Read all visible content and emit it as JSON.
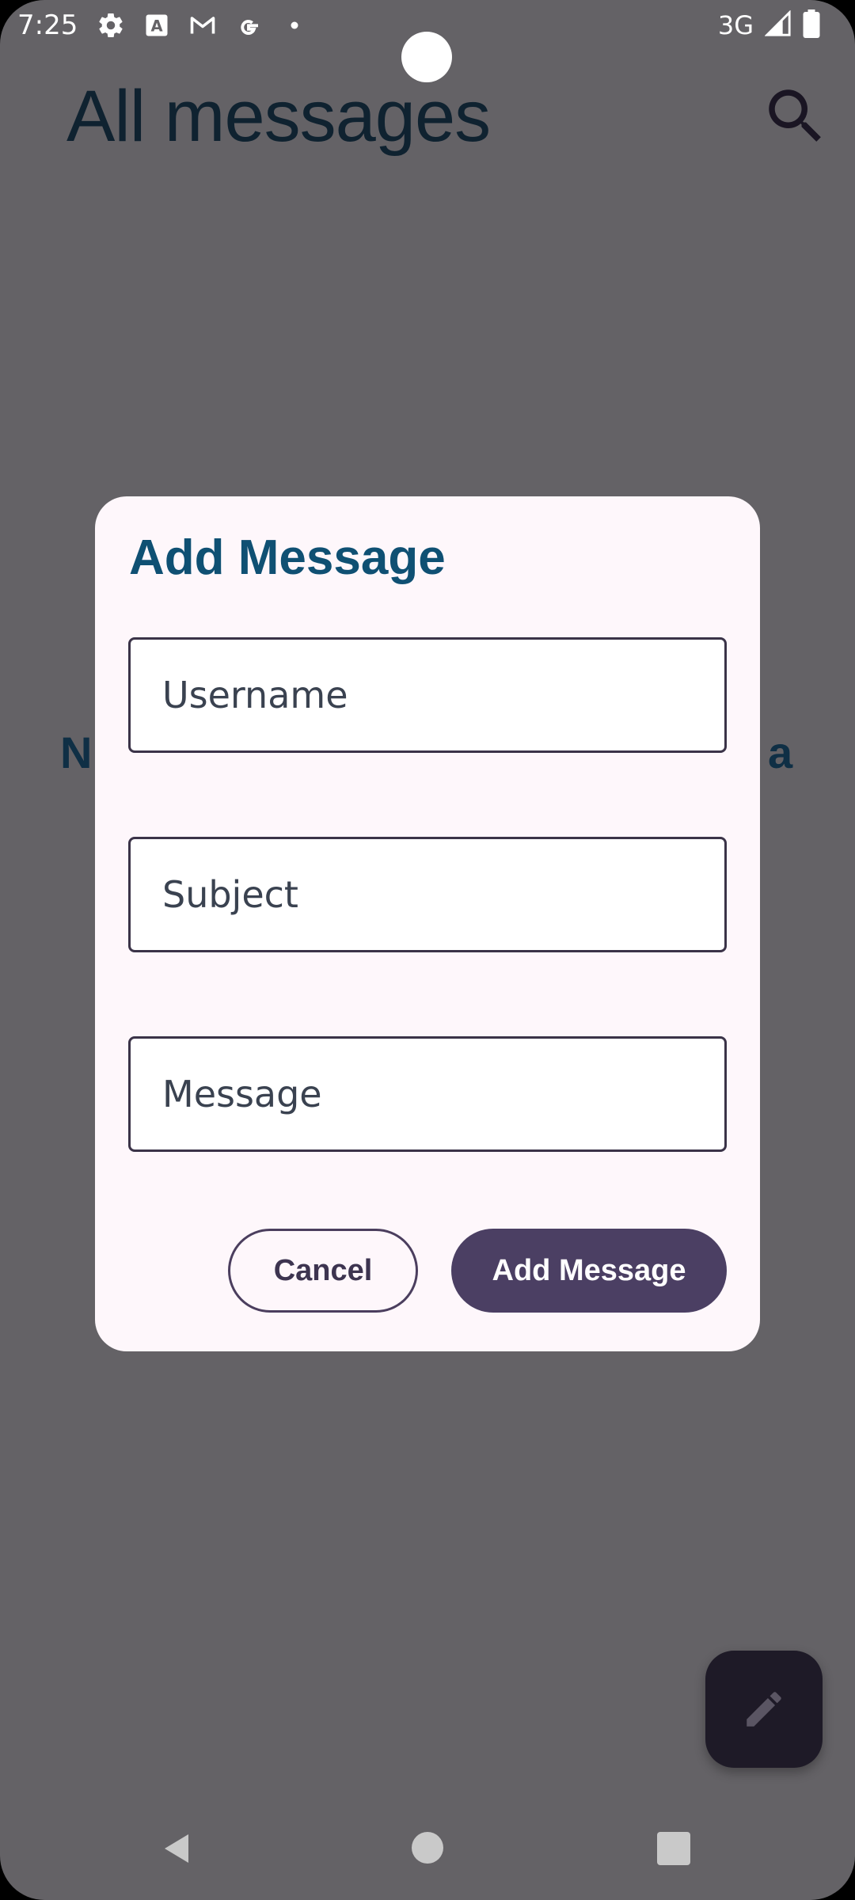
{
  "status_bar": {
    "time": "7:25",
    "network": "3G",
    "left_icons": [
      "settings-icon",
      "a-badge-icon",
      "gmail-icon",
      "google-icon",
      "dot-icon"
    ],
    "right_icons": [
      "signal-icon",
      "battery-icon"
    ]
  },
  "app_bar": {
    "title": "All messages",
    "search_icon": "search-icon"
  },
  "background_peek": {
    "left_char": "N",
    "right_char": "a"
  },
  "dialog": {
    "title": "Add Message",
    "fields": {
      "username": {
        "placeholder": "Username",
        "value": ""
      },
      "subject": {
        "placeholder": "Subject",
        "value": ""
      },
      "message": {
        "placeholder": "Message",
        "value": ""
      }
    },
    "cancel_label": "Cancel",
    "confirm_label": "Add Message"
  },
  "fab": {
    "icon": "edit-pencil-icon"
  },
  "nav_bar": {
    "icons": [
      "back-icon",
      "home-icon",
      "recents-icon"
    ]
  },
  "colors": {
    "scrim": "#646266",
    "dialog_bg": "#fef7fb",
    "dialog_title": "#0f5073",
    "primary_button": "#4b3f63",
    "fab_bg": "#1e1a27"
  }
}
